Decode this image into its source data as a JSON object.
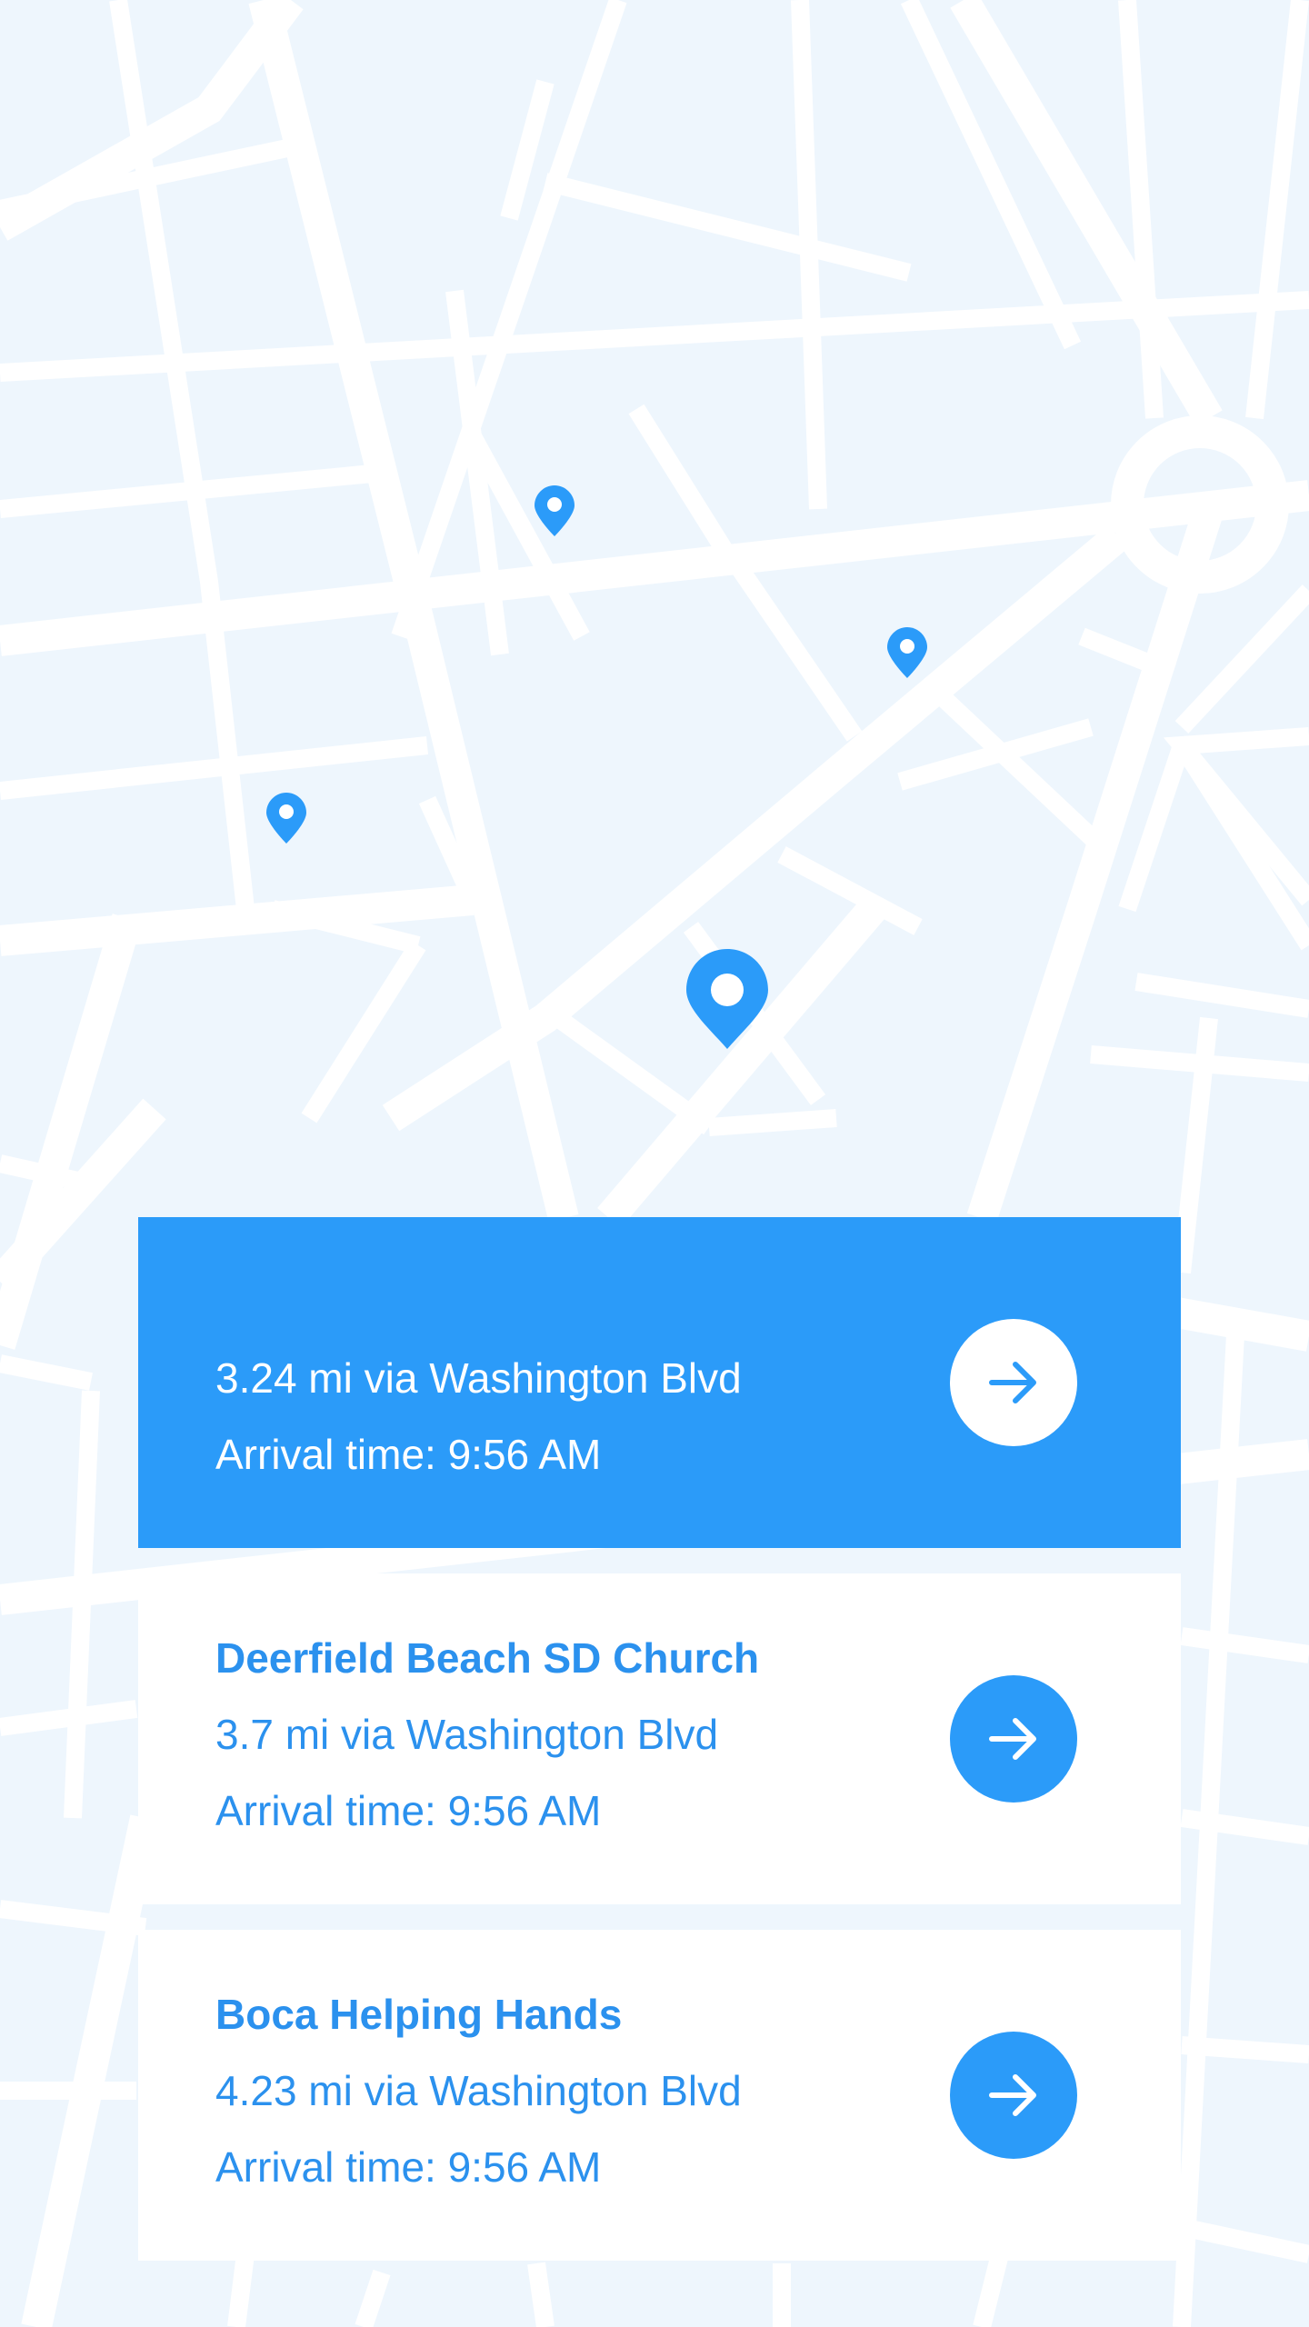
{
  "colors": {
    "accent": "#2b9bf9",
    "map_bg": "#eef6fd",
    "road": "#ffffff"
  },
  "map": {
    "markers": [
      {
        "name": "location-pin-icon",
        "kind": "small"
      },
      {
        "name": "location-pin-icon",
        "kind": "small"
      },
      {
        "name": "location-pin-icon",
        "kind": "small"
      },
      {
        "name": "destination-pin-icon",
        "kind": "large"
      }
    ]
  },
  "routes": [
    {
      "title": "",
      "distance": "3.24 mi via Washington Blvd",
      "arrival": "Arrival time: 9:56 AM",
      "selected": true,
      "action_icon": "arrow-right-icon"
    },
    {
      "title": "Deerfield Beach SD Church",
      "distance": "3.7 mi via Washington Blvd",
      "arrival": "Arrival time: 9:56 AM",
      "selected": false,
      "action_icon": "arrow-right-icon"
    },
    {
      "title": "Boca Helping Hands",
      "distance": "4.23 mi via Washington Blvd",
      "arrival": "Arrival time: 9:56 AM",
      "selected": false,
      "action_icon": "arrow-right-icon"
    }
  ]
}
